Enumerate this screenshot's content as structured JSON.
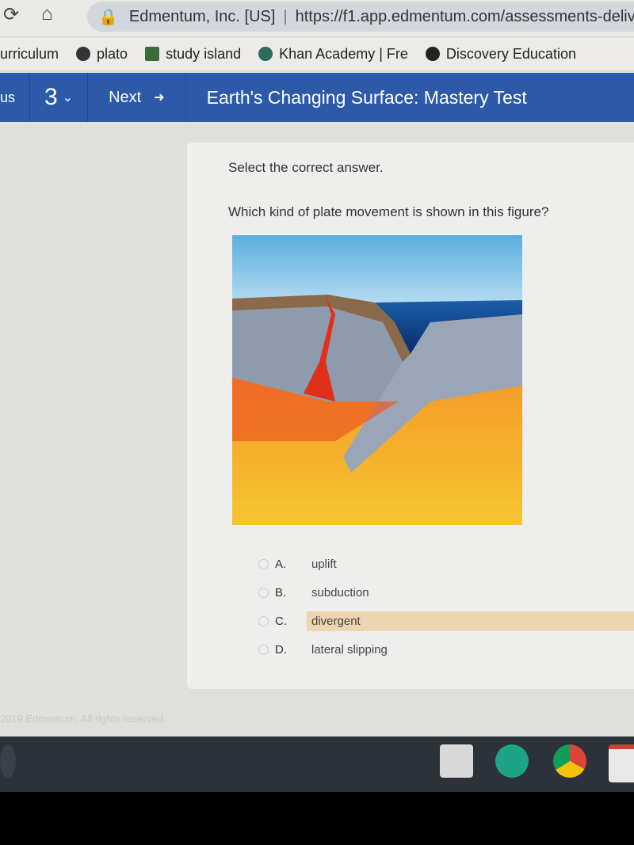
{
  "browser": {
    "site_name": "Edmentum, Inc. [US]",
    "url": "https://f1.app.edmentum.com/assessments-deliv",
    "bookmarks": [
      {
        "label": "urriculum"
      },
      {
        "label": "plato"
      },
      {
        "label": "study island"
      },
      {
        "label": "Khan Academy | Fre"
      },
      {
        "label": "Discovery Education"
      }
    ]
  },
  "toolbar": {
    "prev_label": "us",
    "question_number": "3",
    "next_label": "Next",
    "title": "Earth's Changing Surface: Mastery Test"
  },
  "question": {
    "instruction": "Select the correct answer.",
    "text": "Which kind of plate movement is shown in this figure?",
    "options": [
      {
        "letter": "A.",
        "label": "uplift"
      },
      {
        "letter": "B.",
        "label": "subduction"
      },
      {
        "letter": "C.",
        "label": "divergent",
        "hovered": true
      },
      {
        "letter": "D.",
        "label": "lateral slipping"
      }
    ]
  },
  "footer": {
    "copyright": "2019 Edmentum. All rights reserved."
  },
  "colors": {
    "header_blue": "#2d5aa8",
    "hover": "#ecd5b0"
  }
}
